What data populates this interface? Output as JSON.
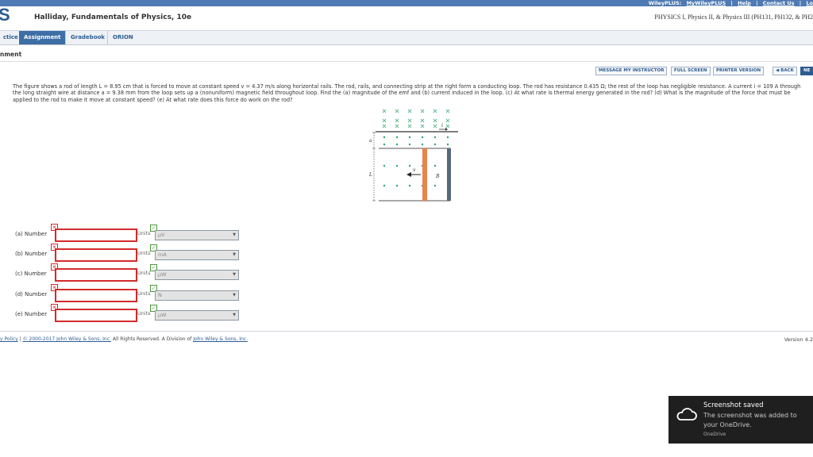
{
  "top_links": {
    "brand": "WileyPLUS:",
    "my_wileyplus": "MyWileyPLUS",
    "help": "Help",
    "contact_us": "Contact Us",
    "log": "Lo"
  },
  "header": {
    "logo_letter": "S",
    "book_title": "Halliday, Fundamentals of Physics, 10e",
    "course_title": "PHYSICS I, Physics II, & Physics III (PH131, PH132, & PH2"
  },
  "nav": {
    "tabs": [
      {
        "label": "ctice"
      },
      {
        "label": "Assignment"
      },
      {
        "label": "Gradebook"
      },
      {
        "label": "ORION"
      }
    ]
  },
  "page_heading": "nment",
  "toolbar": {
    "message_instructor": "MESSAGE MY INSTRUCTOR",
    "full_screen": "FULL SCREEN",
    "printer_version": "PRINTER VERSION",
    "back": "◀ BACK",
    "next": "NE"
  },
  "problem": {
    "text": "The figure shows a rod of length L = 8.95 cm that is forced to move at constant speed v = 4.37 m/s along horizontal rails. The rod, rails, and connecting strip at the right form a conducting loop. The rod has resistance 0.435 Ω; the rest of the loop has negligible resistance. A current i = 109 A through the long straight wire at distance a = 9.38 mm from the loop sets up a (nonuniform) magnetic field throughout loop. Find the (a) magnitude of the emf and (b) current induced in the loop. (c) At what rate is thermal energy generated in the rod? (d) What is the magnitude of the force that must be applied to the rod to make it move at constant speed? (e) At what rate does this force do work on the rod?"
  },
  "figure": {
    "label_a": "a",
    "label_L": "L",
    "label_v": "v",
    "label_B": "B",
    "label_i": "i"
  },
  "answers": [
    {
      "label": "(a) Number",
      "units_label": "Units",
      "unit": "μV"
    },
    {
      "label": "(b) Number",
      "units_label": "Units",
      "unit": "mA"
    },
    {
      "label": "(c) Number",
      "units_label": "Units",
      "unit": "μW"
    },
    {
      "label": "(d) Number",
      "units_label": "Units",
      "unit": "N"
    },
    {
      "label": "(e) Number",
      "units_label": "Units",
      "unit": "μW"
    }
  ],
  "footer": {
    "privacy": "y Policy",
    "separator": "|",
    "copyright": "© 2000-2017 John Wiley & Sons, Inc.",
    "rights": "All Rights Reserved. A Division of",
    "company": "John Wiley & Sons, Inc.",
    "version": "Version 4.2"
  },
  "toast": {
    "title": "Screenshot saved",
    "message": "The screenshot was added to your OneDrive.",
    "source": "OneDrive"
  },
  "colors": {
    "brand_blue": "#2d5c91",
    "error_red": "#d32b2b",
    "rod_orange": "#e8854a",
    "field_green": "#2ca56a"
  }
}
